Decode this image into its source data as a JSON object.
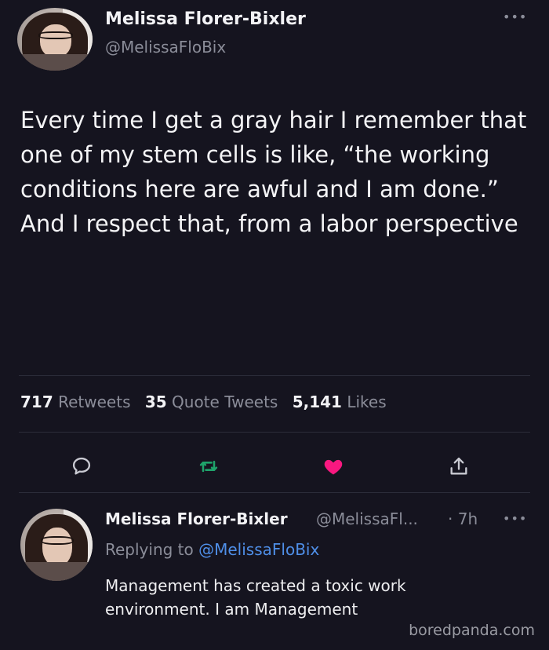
{
  "tweet": {
    "author_name": "Melissa Florer-Bixler",
    "author_handle": "@MelissaFloBix",
    "text": "Every time I get a gray hair I remember that one of my stem cells is like, “the working conditions here are awful and I am done.” And I respect that, from a labor perspective",
    "stats": {
      "retweets_count": "717",
      "retweets_label": "Retweets",
      "quotes_count": "35",
      "quotes_label": "Quote Tweets",
      "likes_count": "5,141",
      "likes_label": "Likes"
    },
    "actions": {
      "reply_icon": "reply-icon",
      "retweet_icon": "retweet-icon",
      "like_icon": "heart-icon",
      "share_icon": "share-icon",
      "retweet_color": "#1fa36b",
      "like_color": "#f91880"
    }
  },
  "reply": {
    "author_name": "Melissa Florer-Bixler",
    "author_handle": "@MelissaFl...",
    "time": "· 7h",
    "replying_prefix": "Replying to",
    "replying_to": "@MelissaFloBix",
    "text": "Management has created a toxic work environment. I am Management"
  },
  "watermark": "boredpanda.com",
  "colors": {
    "background": "#15141f",
    "muted": "#8b8d99",
    "link": "#4f8fe8"
  }
}
